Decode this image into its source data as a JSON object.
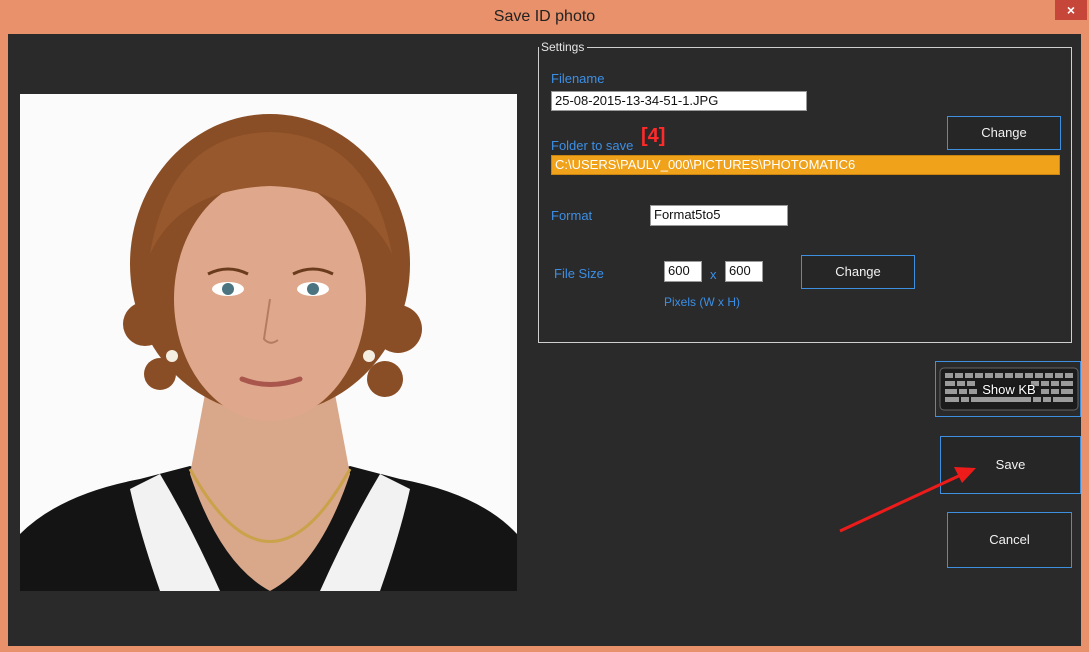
{
  "window": {
    "title": "Save ID photo",
    "close_label": "×"
  },
  "settings": {
    "legend": "Settings",
    "filename_label": "Filename",
    "filename_value": "25-08-2015-13-34-51-1.JPG",
    "folder_label": "Folder to save",
    "folder_marker": "[4]",
    "folder_value": "C:\\USERS\\PAULV_000\\PICTURES\\PHOTOMATIC6",
    "folder_change_label": "Change",
    "format_label": "Format",
    "format_value": "Format5to5",
    "filesize_label": "File Size",
    "width_value": "600",
    "times_label": "x",
    "height_value": "600",
    "pixels_label": "Pixels (W x H)",
    "size_change_label": "Change"
  },
  "actions": {
    "show_kb_label": "Show KB",
    "save_label": "Save",
    "cancel_label": "Cancel"
  },
  "colors": {
    "title_bar": "#e8916a",
    "accent_blue": "#3c8fe6",
    "folder_highlight": "#f0a21b",
    "annotation_red": "#ff2a2a"
  },
  "icons": {
    "close": "close-icon",
    "keyboard": "keyboard-icon",
    "arrow": "annotation-arrow"
  }
}
